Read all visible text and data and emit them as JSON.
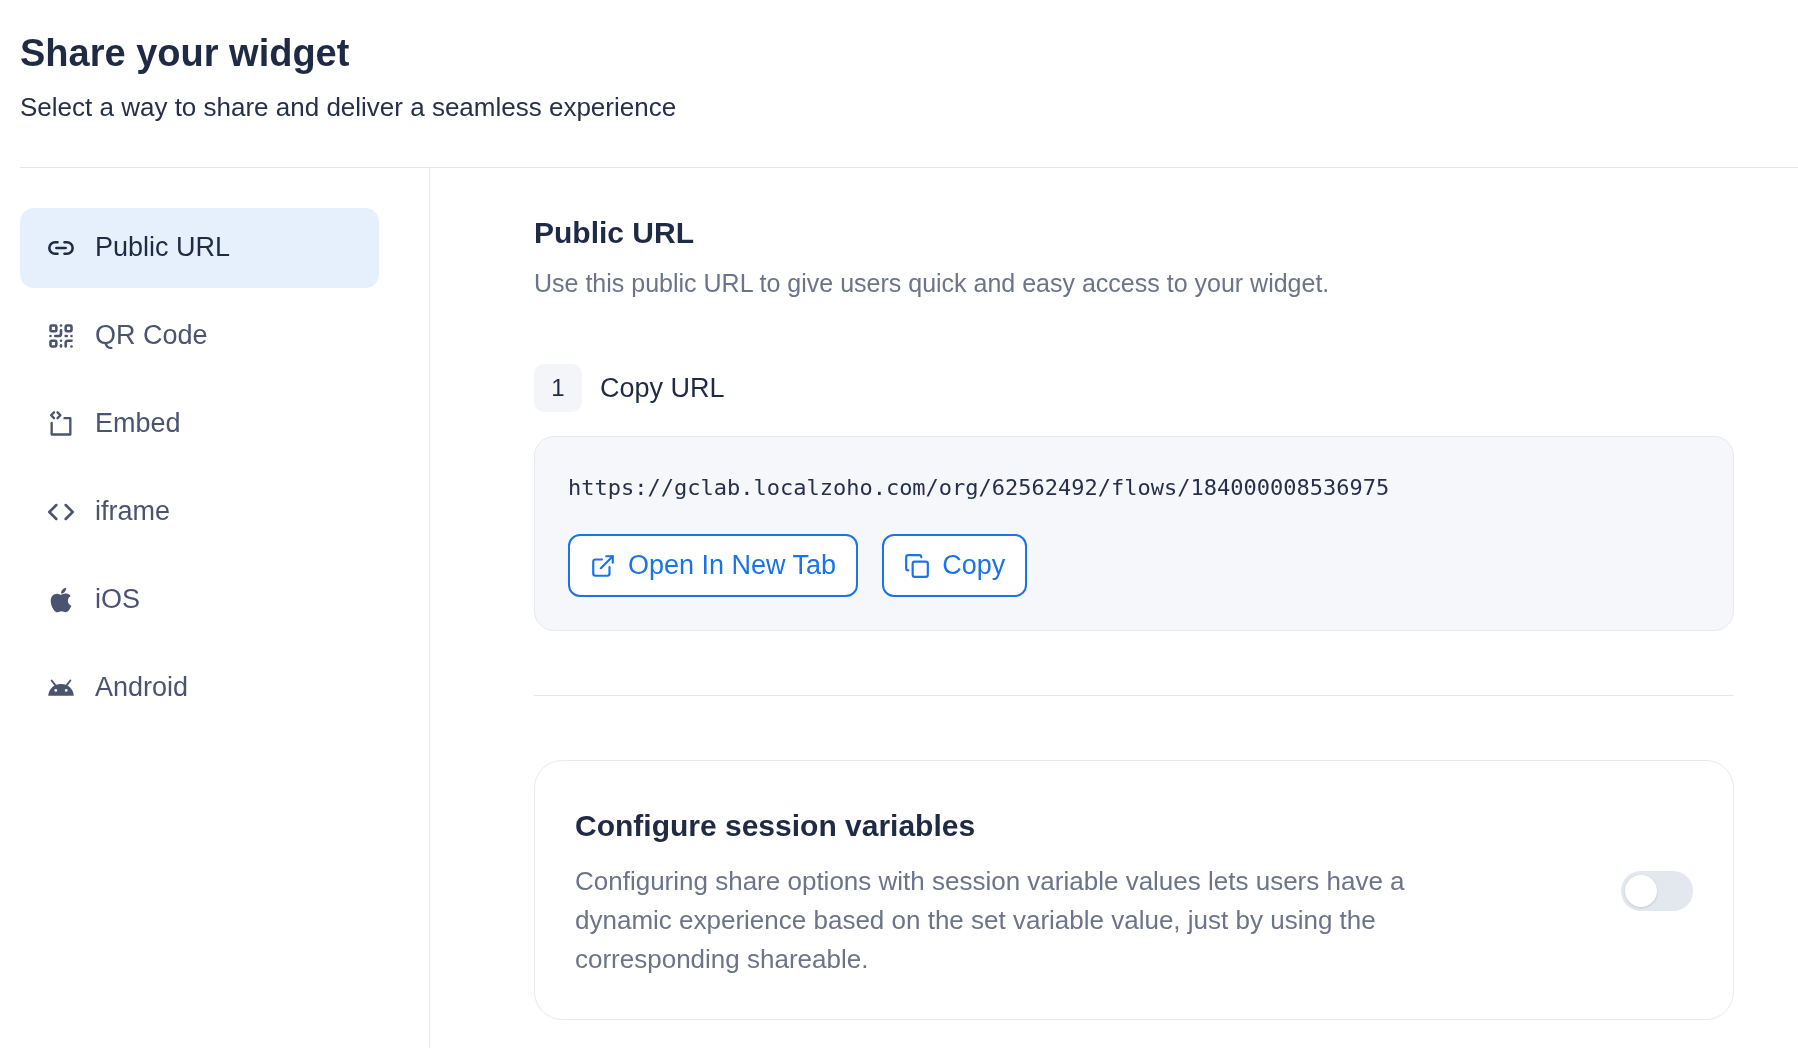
{
  "header": {
    "title": "Share your widget",
    "subtitle": "Select a way to share and deliver a seamless experience"
  },
  "sidebar": {
    "items": [
      {
        "kind": "link",
        "label": "Public URL",
        "selected": true
      },
      {
        "kind": "qr",
        "label": "QR Code",
        "selected": false
      },
      {
        "kind": "embed",
        "label": "Embed",
        "selected": false
      },
      {
        "kind": "code",
        "label": "iframe",
        "selected": false
      },
      {
        "kind": "apple",
        "label": "iOS",
        "selected": false
      },
      {
        "kind": "android",
        "label": "Android",
        "selected": false
      }
    ]
  },
  "section": {
    "title": "Public URL",
    "description": "Use this public URL to give users quick and easy access to your widget.",
    "step": {
      "number": "1",
      "label": "Copy URL"
    },
    "url": "https://gclab.localzoho.com/org/62562492/flows/184000008536975",
    "buttons": [
      {
        "kind": "open",
        "label": "Open In New Tab"
      },
      {
        "kind": "copy",
        "label": "Copy"
      }
    ]
  },
  "session_card": {
    "title": "Configure session variables",
    "description": "Configuring share options with session variable values lets users have a dynamic experience based on the set variable value, just by using the corresponding shareable.",
    "on": false
  }
}
